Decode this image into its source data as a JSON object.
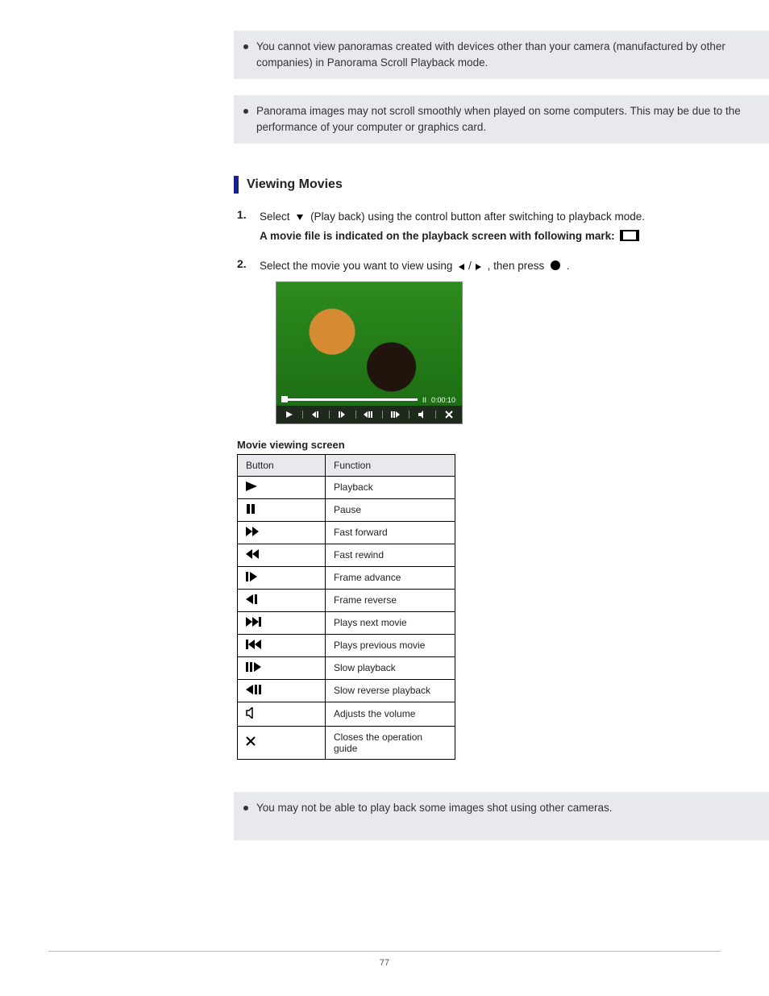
{
  "notes": {
    "note1": "You cannot view panoramas created with devices other than your camera (manufactured by other companies) in Panorama Scroll Playback mode.",
    "note2": "Panorama images may not scroll smoothly when played on some computers. This may be due to the performance of your computer or graphics card."
  },
  "section": {
    "heading": "Viewing Movies"
  },
  "steps": {
    "s1_a": "Select",
    "s1_icon_label": "(Play back)",
    "s1_b": "using the control button after switching to playback mode.",
    "s1_bold": "A movie file is indicated on the playback screen with following mark:",
    "s2_a": "Select the movie you want to view using",
    "s2_b": ", then press",
    "s2_c": "."
  },
  "video": {
    "state_label": "II",
    "timecode": "0:00:10"
  },
  "table": {
    "caption": "Movie viewing screen",
    "col_icon": "Button",
    "col_func": "Function",
    "rows": [
      {
        "icon": "play",
        "label": "Playback"
      },
      {
        "icon": "pause",
        "label": "Pause"
      },
      {
        "icon": "ff",
        "label": "Fast forward"
      },
      {
        "icon": "rew",
        "label": "Fast rewind"
      },
      {
        "icon": "stepfwd",
        "label": "Frame advance"
      },
      {
        "icon": "steprev",
        "label": "Frame reverse"
      },
      {
        "icon": "next",
        "label": "Plays next movie"
      },
      {
        "icon": "prev",
        "label": "Plays previous movie"
      },
      {
        "icon": "slowfwd",
        "label": "Slow playback"
      },
      {
        "icon": "slowrev",
        "label": "Slow reverse playback"
      },
      {
        "icon": "vol",
        "label": "Adjusts the volume"
      },
      {
        "icon": "close",
        "label": "Closes the operation guide"
      }
    ]
  },
  "notes2": {
    "note3": "You may not be able to play back some images shot using other cameras."
  },
  "page_number": "77"
}
